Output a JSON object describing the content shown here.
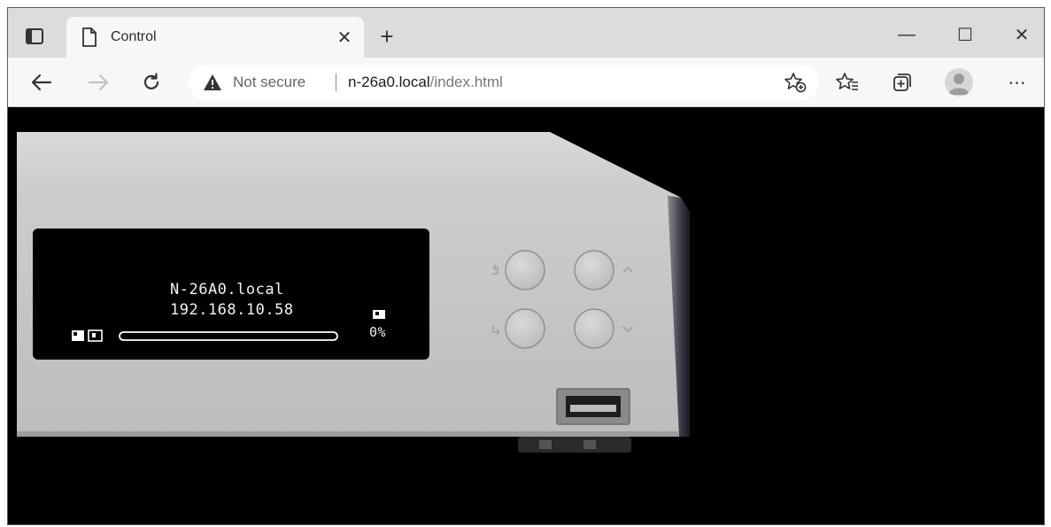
{
  "browser": {
    "tab_title": "Control",
    "tab_close_glyph": "✕",
    "new_tab_glyph": "+",
    "window_controls": {
      "minimize": "—",
      "maximize": "☐",
      "close": "✕"
    },
    "address": {
      "security_label": "Not secure",
      "host": "n-26a0.local",
      "path": "/index.html"
    },
    "menu_glyph": "⋯"
  },
  "device": {
    "display": {
      "hostname": "N-26A0.local",
      "ip_address": "192.168.10.58",
      "percent": "0%",
      "progress": 0
    },
    "colors": {
      "panel": "#c8c8c8",
      "display_bg": "#000000",
      "display_text": "#f2f2f2"
    }
  }
}
